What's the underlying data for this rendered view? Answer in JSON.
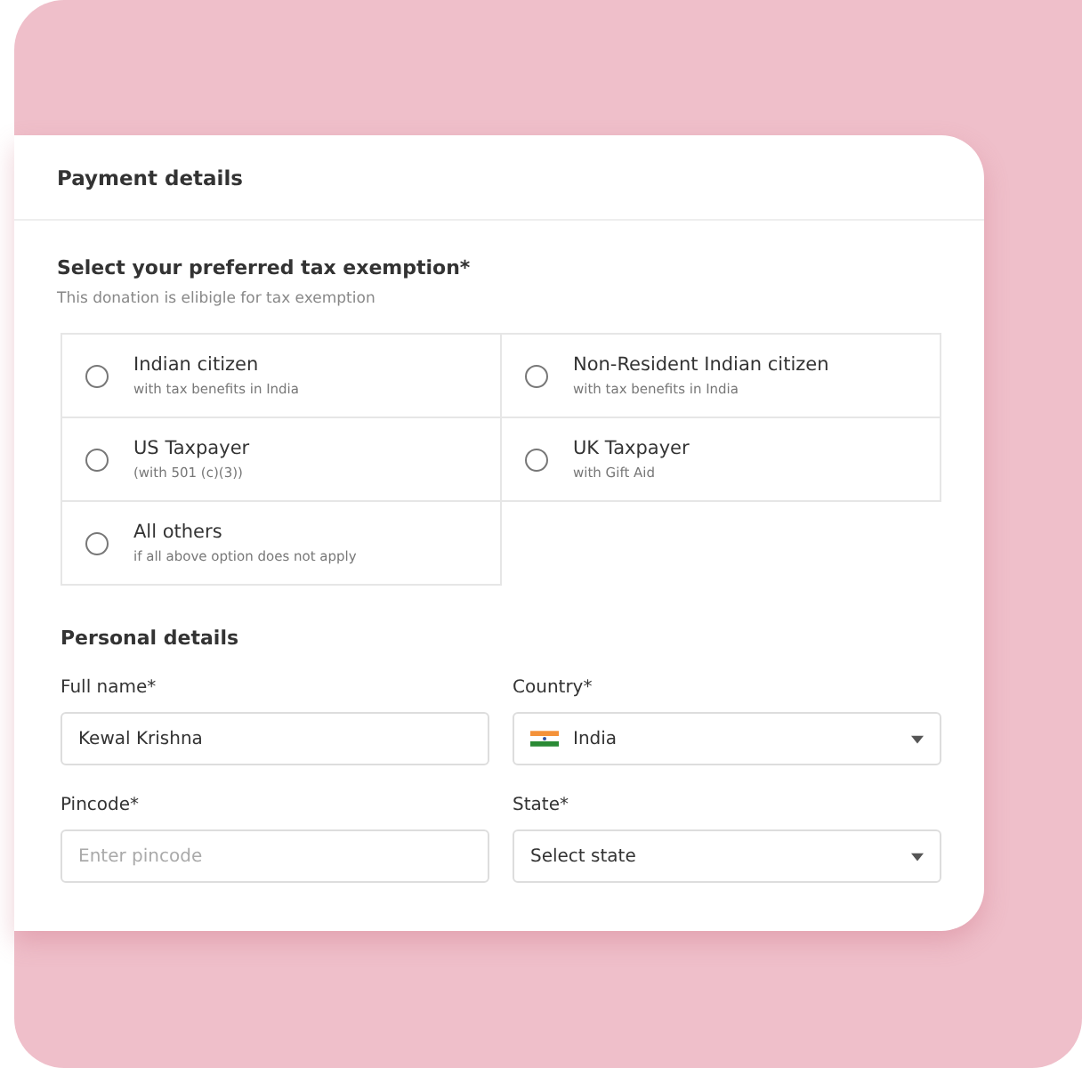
{
  "card": {
    "title": "Payment details"
  },
  "tax_exemption": {
    "title": "Select your preferred tax exemption*",
    "subtitle": "This donation is elibigle for tax exemption",
    "options": [
      {
        "label": "Indian citizen",
        "note": "with tax benefits in India",
        "selected": false
      },
      {
        "label": "Non-Resident Indian citizen",
        "note": "with tax benefits in India",
        "selected": false
      },
      {
        "label": "US Taxpayer",
        "note": "(with 501 (c)(3))",
        "selected": false
      },
      {
        "label": "UK Taxpayer",
        "note": "with Gift Aid",
        "selected": false
      },
      {
        "label": "All others",
        "note": "if all above option does not apply",
        "selected": false
      }
    ]
  },
  "personal_details": {
    "title": "Personal details",
    "fields": [
      {
        "kind": "text",
        "label": "Full name*",
        "value": "Kewal Krishna"
      },
      {
        "kind": "select",
        "label": "Country*",
        "value": "India",
        "flag": true
      },
      {
        "kind": "text",
        "label": "Pincode*",
        "placeholder": "Enter pincode"
      },
      {
        "kind": "select",
        "label": "State*",
        "value": "Select state"
      }
    ]
  }
}
